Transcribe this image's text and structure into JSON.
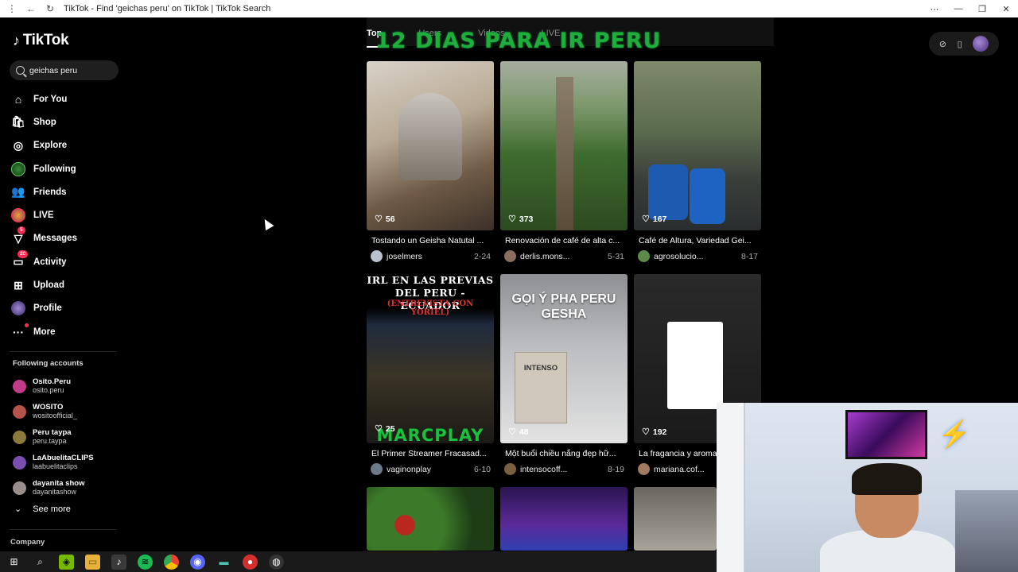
{
  "browser": {
    "title": "TikTok - Find 'geichas peru' on TikTok | TikTok Search"
  },
  "sidebar": {
    "logo": "TikTok",
    "search_value": "geichas peru",
    "menu": [
      {
        "label": "For You",
        "icon": "home-icon"
      },
      {
        "label": "Shop",
        "icon": "shop-icon"
      },
      {
        "label": "Explore",
        "icon": "compass-icon"
      },
      {
        "label": "Following",
        "icon": "following-avatar-icon"
      },
      {
        "label": "Friends",
        "icon": "friends-icon"
      },
      {
        "label": "LIVE",
        "icon": "live-avatar-icon"
      },
      {
        "label": "Messages",
        "icon": "messages-icon",
        "badge": "5"
      },
      {
        "label": "Activity",
        "icon": "activity-icon",
        "badge": "20"
      },
      {
        "label": "Upload",
        "icon": "upload-icon"
      },
      {
        "label": "Profile",
        "icon": "profile-avatar-icon"
      },
      {
        "label": "More",
        "icon": "more-icon"
      }
    ],
    "following_title": "Following accounts",
    "accounts": [
      {
        "name": "Osito.Peru",
        "handle": "osito.peru",
        "color": "#c23b8a"
      },
      {
        "name": "WOSITO",
        "handle": "wositoofficial_",
        "color": "#b4544a"
      },
      {
        "name": "Peru taypa",
        "handle": "peru.taypa",
        "color": "#8a7b3c"
      },
      {
        "name": "LaAbuelitaCLIPS",
        "handle": "laabuelitaclips",
        "color": "#7b4fb0"
      },
      {
        "name": "dayanita show",
        "handle": "dayanitashow",
        "color": "#9a8f88"
      }
    ],
    "see_more": "See more",
    "company": "Company"
  },
  "tabs": [
    {
      "label": "Top",
      "active": true
    },
    {
      "label": "Users",
      "active": false
    },
    {
      "label": "Videos",
      "active": false
    },
    {
      "label": "LIVE",
      "active": false
    }
  ],
  "overlay_text": "12 DIAS PARA IR PERU",
  "videos": [
    {
      "likes": "56",
      "title": "Tostando un Geisha Natutal ...",
      "user": "joselmers",
      "date": "2-24"
    },
    {
      "likes": "373",
      "title": "Renovación de café de alta c...",
      "user": "derlis.mons...",
      "date": "5-31"
    },
    {
      "likes": "167",
      "title": "Café de Altura, Variedad Gei...",
      "user": "agrosolucio...",
      "date": "8-17"
    },
    {
      "likes": "25",
      "title": "El Primer Streamer Fracasad...",
      "user": "vaginonplay",
      "date": "6-10",
      "caption_top": "IRL EN LAS PREVIAS DEL PERU - ECUADOR",
      "caption_sub": "(ENTREVISTA CON YORIEL)",
      "caption_bottom": "MARCPLAY"
    },
    {
      "likes": "48",
      "title": "Một buổi chiều nắng đẹp hữ...",
      "user": "intensocoff...",
      "date": "8-19",
      "caption_top": "GỌI Ý PHA PERU GESHA",
      "caption_bag": "INTENSO"
    },
    {
      "likes": "192",
      "title": "La fragancia y aroma",
      "user": "mariana.cof...",
      "date": "2"
    }
  ],
  "taskbar": [
    "start-icon",
    "search-icon",
    "nvidia-icon",
    "files-icon",
    "tiktok-icon",
    "spotify-icon",
    "chrome-icon",
    "discord-icon",
    "terminal-icon",
    "app-icon",
    "obs-icon"
  ]
}
